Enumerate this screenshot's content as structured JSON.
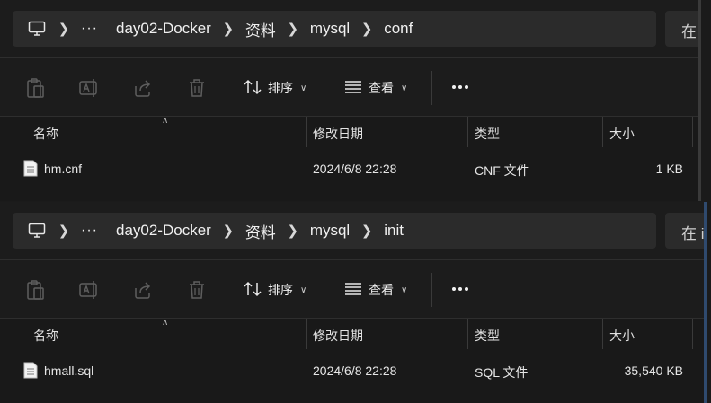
{
  "windows": [
    {
      "address": {
        "crumbs": [
          "day02-Docker",
          "资料",
          "mysql",
          "conf"
        ],
        "ellipsis": "···"
      },
      "search_text": "在",
      "toolbar": {
        "sort_label": "排序",
        "view_label": "查看"
      },
      "columns": {
        "name": "名称",
        "modified": "修改日期",
        "type": "类型",
        "size": "大小"
      },
      "files": [
        {
          "name": "hm.cnf",
          "modified": "2024/6/8 22:28",
          "type": "CNF 文件",
          "size": "1 KB"
        }
      ]
    },
    {
      "address": {
        "crumbs": [
          "day02-Docker",
          "资料",
          "mysql",
          "init"
        ],
        "ellipsis": "···"
      },
      "search_text": "在 i",
      "toolbar": {
        "sort_label": "排序",
        "view_label": "查看"
      },
      "columns": {
        "name": "名称",
        "modified": "修改日期",
        "type": "类型",
        "size": "大小"
      },
      "files": [
        {
          "name": "hmall.sql",
          "modified": "2024/6/8 22:28",
          "type": "SQL 文件",
          "size": "35,540 KB"
        }
      ]
    }
  ],
  "icons": [
    "computer-icon",
    "chevron-right-icon",
    "paste-icon",
    "rename-icon",
    "share-icon",
    "delete-icon",
    "sort-icon",
    "view-icon",
    "more-icon",
    "file-icon"
  ]
}
